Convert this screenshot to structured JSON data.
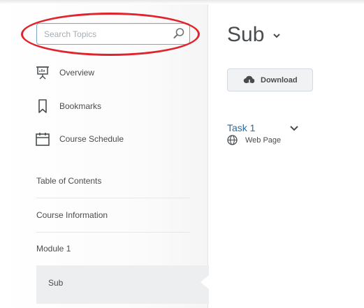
{
  "search": {
    "placeholder": "Search Topics"
  },
  "nav": {
    "items": [
      {
        "label": "Overview",
        "icon": "presentation-board-icon"
      },
      {
        "label": "Bookmarks",
        "icon": "bookmark-icon"
      },
      {
        "label": "Course Schedule",
        "icon": "calendar-icon"
      }
    ]
  },
  "toc": {
    "heading": "Table of Contents",
    "modules": [
      {
        "label": "Course Information"
      },
      {
        "label": "Module 1"
      },
      {
        "label": "Sub",
        "selected": true
      }
    ]
  },
  "main": {
    "title": "Sub",
    "download_label": "Download",
    "topic": {
      "title": "Task 1",
      "type": "Web Page"
    }
  },
  "colors": {
    "highlight": "#e0242c",
    "link": "#2b6aa3",
    "search_border": "#7fa4c4",
    "selected_bg": "#edeef0"
  }
}
